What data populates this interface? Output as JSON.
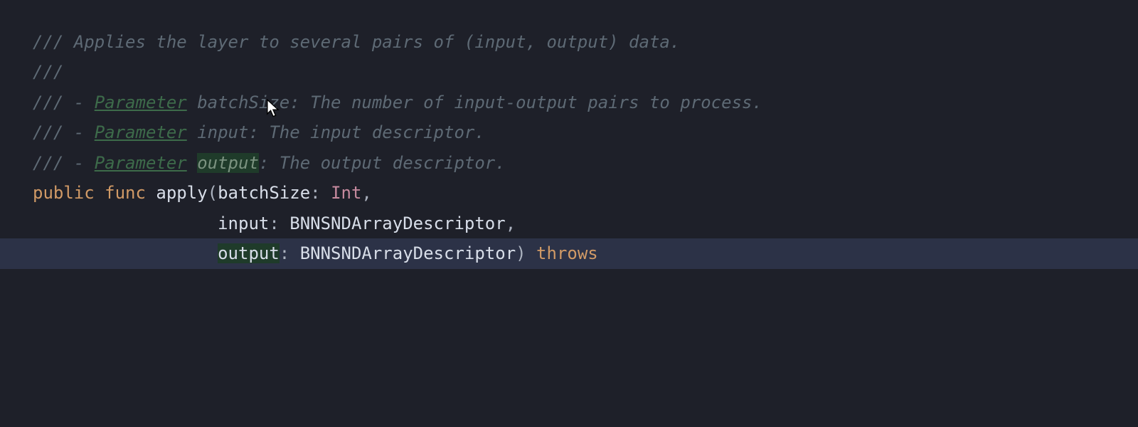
{
  "editor": {
    "cursor_icon": "cursor-arrow",
    "highlighted_line_index": 7,
    "lines": [
      {
        "type": "comment",
        "slashes": "/// ",
        "text": "Applies the layer to several pairs of (input, output) data."
      },
      {
        "type": "comment",
        "slashes": "///",
        "text": ""
      },
      {
        "type": "doc-param",
        "slashes": "/// - ",
        "param_kw": "Parameter",
        "space": " ",
        "param_name": "batchSize",
        "tail": ": The number of input-output pairs to process."
      },
      {
        "type": "doc-param",
        "slashes": "/// - ",
        "param_kw": "Parameter",
        "space": " ",
        "param_name": "input",
        "tail": ": The input descriptor."
      },
      {
        "type": "doc-param-hl",
        "slashes": "/// - ",
        "param_kw": "Parameter",
        "space": " ",
        "param_name": "output",
        "tail": ": The output descriptor."
      },
      {
        "type": "sig-line-1",
        "kw_public": "public",
        "kw_func": "func",
        "func_name": "apply",
        "open": "(",
        "p1_name": "batchSize",
        "colon": ": ",
        "p1_type": "Int",
        "comma": ","
      },
      {
        "type": "sig-line-2",
        "indent": "                  ",
        "p2_name": "input",
        "colon": ": ",
        "p2_type": "BNNSNDArrayDescriptor",
        "comma": ","
      },
      {
        "type": "sig-line-3",
        "indent": "                  ",
        "p3_name": "output",
        "colon": ": ",
        "p3_type": "BNNSNDArrayDescriptor",
        "close": ") ",
        "kw_throws": "throws"
      }
    ]
  }
}
